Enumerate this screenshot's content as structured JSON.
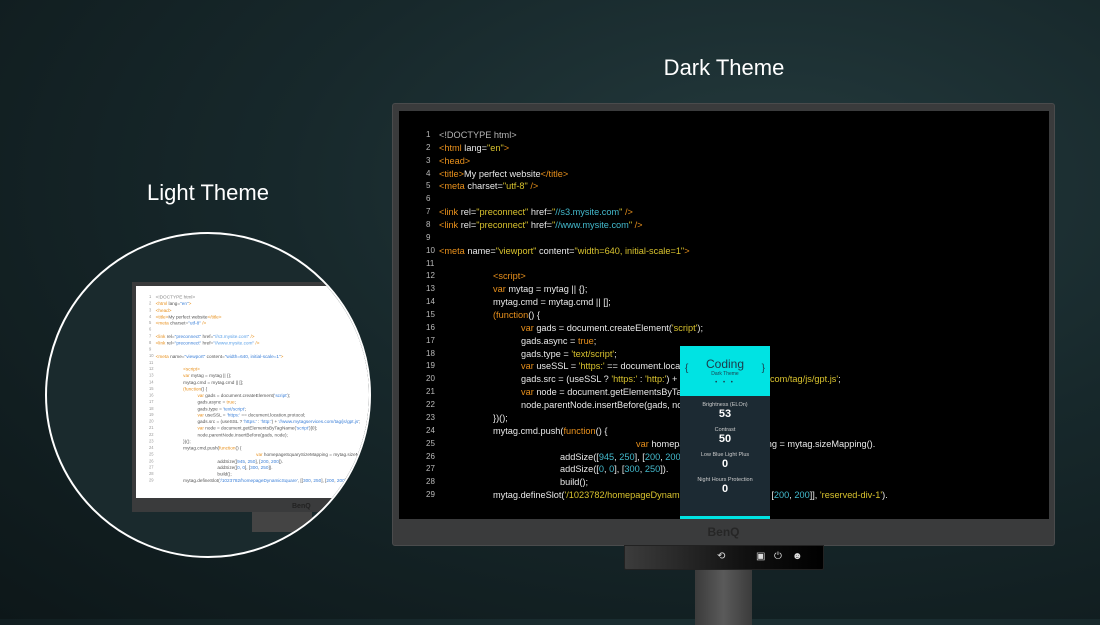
{
  "headings": {
    "dark": "Dark Theme",
    "light": "Light Theme"
  },
  "brand": "BenQ",
  "colors": {
    "accent": "#00e3e3",
    "osd_bg": "#1c2a33",
    "tag": "#e8901c",
    "string_dark": "#d8c22e",
    "string_light": "#3a7fd8",
    "number": "#43b9cc"
  },
  "osd": {
    "mode": "Coding",
    "sub": "Dark Theme",
    "left": "{",
    "right": "}",
    "dots": "• • •",
    "items": [
      {
        "label": "Brightness (ELOn)",
        "value": "53"
      },
      {
        "label": "Contrast",
        "value": "50"
      },
      {
        "label": "Low Blue Light Plus",
        "value": "0"
      },
      {
        "label": "Night Hours Protection",
        "value": "0"
      }
    ]
  },
  "controls": [
    {
      "icon": "link-icon",
      "glyph": "⟲"
    },
    {
      "icon": "input-icon",
      "glyph": "▣"
    },
    {
      "icon": "power-icon",
      "glyph": "⏻"
    },
    {
      "icon": "eye-care-icon",
      "glyph": "☻"
    }
  ],
  "code": [
    {
      "i": 0,
      "t": [
        [
          "g",
          "<!DOCTYPE html>"
        ]
      ]
    },
    {
      "i": 0,
      "t": [
        [
          "o",
          "<html"
        ],
        [
          "p",
          " lang="
        ],
        [
          "s",
          "\"en\""
        ],
        [
          "o",
          ">"
        ]
      ]
    },
    {
      "i": 0,
      "t": [
        [
          "o",
          "<head>"
        ]
      ]
    },
    {
      "i": 0,
      "t": [
        [
          "o",
          "<title>"
        ],
        [
          "p",
          "My perfect website"
        ],
        [
          "o",
          "</title>"
        ]
      ]
    },
    {
      "i": 0,
      "t": [
        [
          "o",
          "<meta"
        ],
        [
          "p",
          " charset="
        ],
        [
          "s",
          "\"utf-8\""
        ],
        [
          "o",
          " />"
        ]
      ]
    },
    {
      "i": 0,
      "t": []
    },
    {
      "i": 0,
      "t": [
        [
          "o",
          "<link"
        ],
        [
          "p",
          " rel="
        ],
        [
          "s",
          "\"preconnect\""
        ],
        [
          "p",
          " href="
        ],
        [
          "s",
          "\""
        ],
        [
          "u",
          "//s3.mysite.com"
        ],
        [
          "s",
          "\""
        ],
        [
          "o",
          " />"
        ]
      ]
    },
    {
      "i": 0,
      "t": [
        [
          "o",
          "<link"
        ],
        [
          "p",
          " rel="
        ],
        [
          "s",
          "\"preconnect\""
        ],
        [
          "p",
          " href="
        ],
        [
          "s",
          "\""
        ],
        [
          "u",
          "//www.mysite.com"
        ],
        [
          "s",
          "\""
        ],
        [
          "o",
          " />"
        ]
      ]
    },
    {
      "i": 0,
      "t": []
    },
    {
      "i": 0,
      "t": [
        [
          "o",
          "<meta"
        ],
        [
          "p",
          " name="
        ],
        [
          "s",
          "\"viewport\""
        ],
        [
          "p",
          " content="
        ],
        [
          "s",
          "\"width=640, initial-scale=1\""
        ],
        [
          "o",
          ">"
        ]
      ]
    },
    {
      "i": 0,
      "t": []
    },
    {
      "i": 1,
      "t": [
        [
          "o",
          "<script>"
        ]
      ]
    },
    {
      "i": 1,
      "t": [
        [
          "o",
          "var"
        ],
        [
          "p",
          " mytag = mytag || {};"
        ]
      ]
    },
    {
      "i": 1,
      "t": [
        [
          "p",
          "mytag.cmd = mytag.cmd || [];"
        ]
      ]
    },
    {
      "i": 1,
      "t": [
        [
          "o",
          "(function"
        ],
        [
          "p",
          "() {"
        ]
      ]
    },
    {
      "i": 2,
      "t": [
        [
          "o",
          "var"
        ],
        [
          "p",
          " gads = document.createElement("
        ],
        [
          "s",
          "'script'"
        ],
        [
          "p",
          ");"
        ]
      ]
    },
    {
      "i": 2,
      "t": [
        [
          "p",
          "gads.async = "
        ],
        [
          "o",
          "true"
        ],
        [
          "p",
          ";"
        ]
      ]
    },
    {
      "i": 2,
      "t": [
        [
          "p",
          "gads.type = "
        ],
        [
          "s",
          "'text/script'"
        ],
        [
          "p",
          ";"
        ]
      ]
    },
    {
      "i": 2,
      "t": [
        [
          "o",
          "var"
        ],
        [
          "p",
          " useSSL = "
        ],
        [
          "s",
          "'https:'"
        ],
        [
          "p",
          " == document.location.protocol;"
        ]
      ]
    },
    {
      "i": 2,
      "t": [
        [
          "p",
          "gads.src = (useSSL ? "
        ],
        [
          "s",
          "'https:'"
        ],
        [
          "p",
          " : "
        ],
        [
          "s",
          "'http:'"
        ],
        [
          "p",
          ") + "
        ],
        [
          "s",
          "'//www.mytagservices.com/tag/js/gpt.js'"
        ],
        [
          "p",
          ";"
        ]
      ]
    },
    {
      "i": 2,
      "t": [
        [
          "o",
          "var"
        ],
        [
          "p",
          " node = document.getElementsByTagName("
        ],
        [
          "s",
          "'script'"
        ],
        [
          "p",
          ")[0];"
        ]
      ]
    },
    {
      "i": 2,
      "t": [
        [
          "p",
          "node.parentNode.insertBefore(gads, node);"
        ]
      ]
    },
    {
      "i": 1,
      "t": [
        [
          "p",
          "})();"
        ]
      ]
    },
    {
      "i": 1,
      "t": [
        [
          "p",
          "mytag.cmd.push("
        ],
        [
          "o",
          "function"
        ],
        [
          "p",
          "() {"
        ]
      ]
    },
    {
      "i": 4,
      "t": [
        [
          "o",
          "var"
        ],
        [
          "p",
          " homepageSquarySizeMapping = mytag.sizeMapping()."
        ]
      ]
    },
    {
      "i": 3,
      "t": [
        [
          "p",
          "addSize(["
        ],
        [
          "n",
          "945"
        ],
        [
          "p",
          ", "
        ],
        [
          "n",
          "250"
        ],
        [
          "p",
          "], ["
        ],
        [
          "n",
          "200"
        ],
        [
          "p",
          ", "
        ],
        [
          "n",
          "200"
        ],
        [
          "p",
          "])."
        ]
      ]
    },
    {
      "i": 3,
      "t": [
        [
          "p",
          "addSize(["
        ],
        [
          "n",
          "0"
        ],
        [
          "p",
          ", "
        ],
        [
          "n",
          "0"
        ],
        [
          "p",
          "], ["
        ],
        [
          "n",
          "300"
        ],
        [
          "p",
          ", "
        ],
        [
          "n",
          "250"
        ],
        [
          "p",
          "])."
        ]
      ]
    },
    {
      "i": 3,
      "t": [
        [
          "p",
          "build();"
        ]
      ]
    },
    {
      "i": 1,
      "t": [
        [
          "p",
          "mytag.defineSlot("
        ],
        [
          "s",
          "'/1023782/homepageDynamicSquare'"
        ],
        [
          "p",
          ", [["
        ],
        [
          "n",
          "300"
        ],
        [
          "p",
          ", "
        ],
        [
          "n",
          "250"
        ],
        [
          "p",
          "], ["
        ],
        [
          "n",
          "200"
        ],
        [
          "p",
          ", "
        ],
        [
          "n",
          "200"
        ],
        [
          "p",
          "]], "
        ],
        [
          "s",
          "'reserved-div-1'"
        ],
        [
          "p",
          ")."
        ]
      ]
    }
  ]
}
